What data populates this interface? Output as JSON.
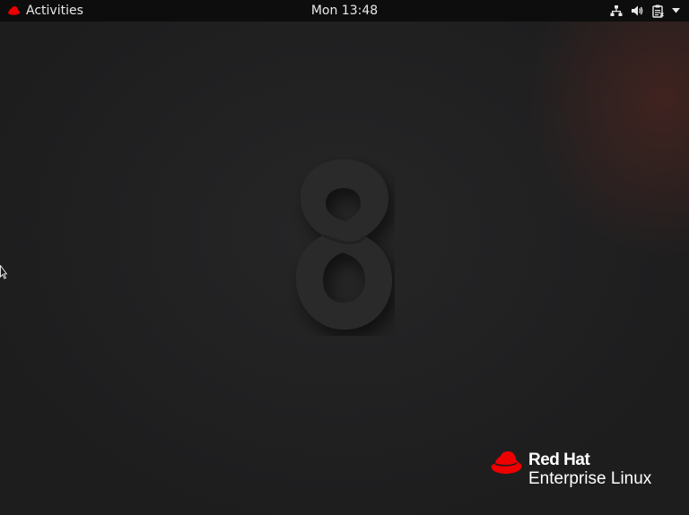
{
  "topbar": {
    "activities_label": "Activities",
    "clock": "Mon 13:48",
    "tray_icons": [
      "network-wired-icon",
      "volume-icon",
      "clipboard-icon",
      "dropdown-arrow-icon"
    ]
  },
  "wallpaper": {
    "emblem": "8",
    "brand_line1": "Red Hat",
    "brand_line2": "Enterprise Linux"
  },
  "colors": {
    "topbar_bg": "#0d0d0d",
    "desktop_bg": "#1f1f20",
    "redhat_red": "#ee0000",
    "text": "#ffffff"
  }
}
